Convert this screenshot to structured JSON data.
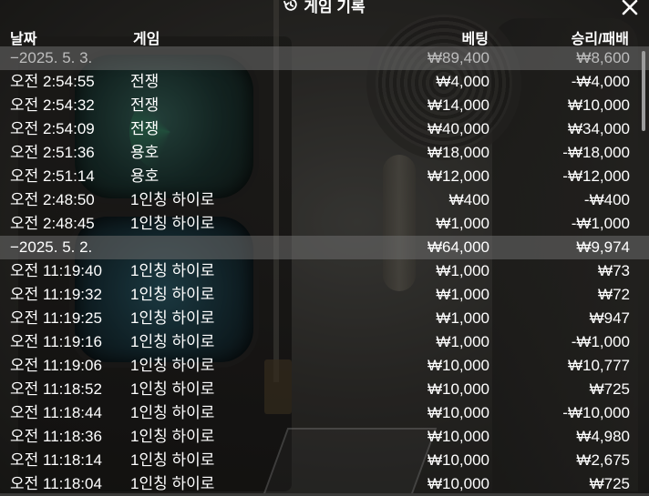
{
  "header": {
    "title": "게임 기록"
  },
  "columns": {
    "date": "날짜",
    "game": "게임",
    "bet": "베팅",
    "winloss": "승리/패배"
  },
  "groups": [
    {
      "date_label": "−2025. 5. 3.",
      "total_bet": "₩89,400",
      "total_winloss": "₩8,600",
      "rows": [
        {
          "time": "오전 2:54:55",
          "game": "전쟁",
          "bet": "₩4,000",
          "winloss": "-₩4,000"
        },
        {
          "time": "오전 2:54:32",
          "game": "전쟁",
          "bet": "₩14,000",
          "winloss": "₩10,000"
        },
        {
          "time": "오전 2:54:09",
          "game": "전쟁",
          "bet": "₩40,000",
          "winloss": "₩34,000"
        },
        {
          "time": "오전 2:51:36",
          "game": "용호",
          "bet": "₩18,000",
          "winloss": "-₩18,000"
        },
        {
          "time": "오전 2:51:14",
          "game": "용호",
          "bet": "₩12,000",
          "winloss": "-₩12,000"
        },
        {
          "time": "오전 2:48:50",
          "game": "1인칭 하이로",
          "bet": "₩400",
          "winloss": "-₩400"
        },
        {
          "time": "오전 2:48:45",
          "game": "1인칭 하이로",
          "bet": "₩1,000",
          "winloss": "-₩1,000"
        }
      ]
    },
    {
      "date_label": "−2025. 5. 2.",
      "total_bet": "₩64,000",
      "total_winloss": "₩9,974",
      "rows": [
        {
          "time": "오전 11:19:40",
          "game": "1인칭 하이로",
          "bet": "₩1,000",
          "winloss": "₩73"
        },
        {
          "time": "오전 11:19:32",
          "game": "1인칭 하이로",
          "bet": "₩1,000",
          "winloss": "₩72"
        },
        {
          "time": "오전 11:19:25",
          "game": "1인칭 하이로",
          "bet": "₩1,000",
          "winloss": "₩947"
        },
        {
          "time": "오전 11:19:16",
          "game": "1인칭 하이로",
          "bet": "₩1,000",
          "winloss": "-₩1,000"
        },
        {
          "time": "오전 11:19:06",
          "game": "1인칭 하이로",
          "bet": "₩10,000",
          "winloss": "₩10,777"
        },
        {
          "time": "오전 11:18:52",
          "game": "1인칭 하이로",
          "bet": "₩10,000",
          "winloss": "₩725"
        },
        {
          "time": "오전 11:18:44",
          "game": "1인칭 하이로",
          "bet": "₩10,000",
          "winloss": "-₩10,000"
        },
        {
          "time": "오전 11:18:36",
          "game": "1인칭 하이로",
          "bet": "₩10,000",
          "winloss": "₩4,980"
        },
        {
          "time": "오전 11:18:14",
          "game": "1인칭 하이로",
          "bet": "₩10,000",
          "winloss": "₩2,675"
        },
        {
          "time": "오전 11:18:04",
          "game": "1인칭 하이로",
          "bet": "₩10,000",
          "winloss": "₩725"
        }
      ]
    }
  ],
  "icons": {
    "title_icon": "history-icon",
    "close": "close-icon"
  }
}
